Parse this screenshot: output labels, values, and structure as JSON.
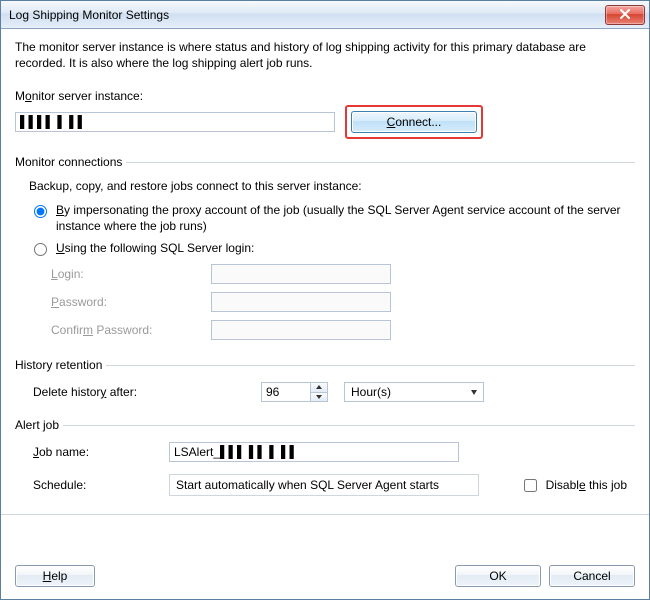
{
  "window": {
    "title": "Log Shipping Monitor Settings"
  },
  "intro": "The monitor server instance is where status and history of log shipping activity for this primary database are recorded. It is also where the log shipping alert job runs.",
  "monitor": {
    "label_pre": "M",
    "label_u": "o",
    "label_post": "nitor server instance:",
    "value": "▌▌▌▌ ▌ ▌▌",
    "connect_pre": "",
    "connect_u": "C",
    "connect_post": "onnect..."
  },
  "connections": {
    "legend": "Monitor connections",
    "sub": "Backup, copy, and restore jobs connect to this server instance:",
    "radio1_pre": "",
    "radio1_u": "B",
    "radio1_post": "y impersonating the proxy account of the job (usually the SQL Server Agent service account of the server instance where the job runs)",
    "radio2_pre": "",
    "radio2_u": "U",
    "radio2_post": "sing the following SQL Server login:",
    "login_pre": "",
    "login_u": "L",
    "login_post": "ogin:",
    "pwd_pre": "",
    "pwd_u": "P",
    "pwd_post": "assword:",
    "cpwd_pre": "Confir",
    "cpwd_u": "m",
    "cpwd_post": " Password:"
  },
  "history": {
    "legend": "History retention",
    "label_pre": "Delete histor",
    "label_u": "y",
    "label_post": " after:",
    "value": "96",
    "unit": "Hour(s)"
  },
  "alert": {
    "legend": "Alert job",
    "jobname_pre": "",
    "jobname_u": "J",
    "jobname_post": "ob name:",
    "jobname_value": "LSAlert_▌▌▌ ▌▌ ▌ ▌▌",
    "schedule_label": "Schedule:",
    "schedule_value": "Start automatically when SQL Server Agent starts",
    "disable_pre": "Disabl",
    "disable_u": "e",
    "disable_post": " this job"
  },
  "buttons": {
    "help_pre": "",
    "help_u": "H",
    "help_post": "elp",
    "ok": "OK",
    "cancel": "Cancel"
  }
}
